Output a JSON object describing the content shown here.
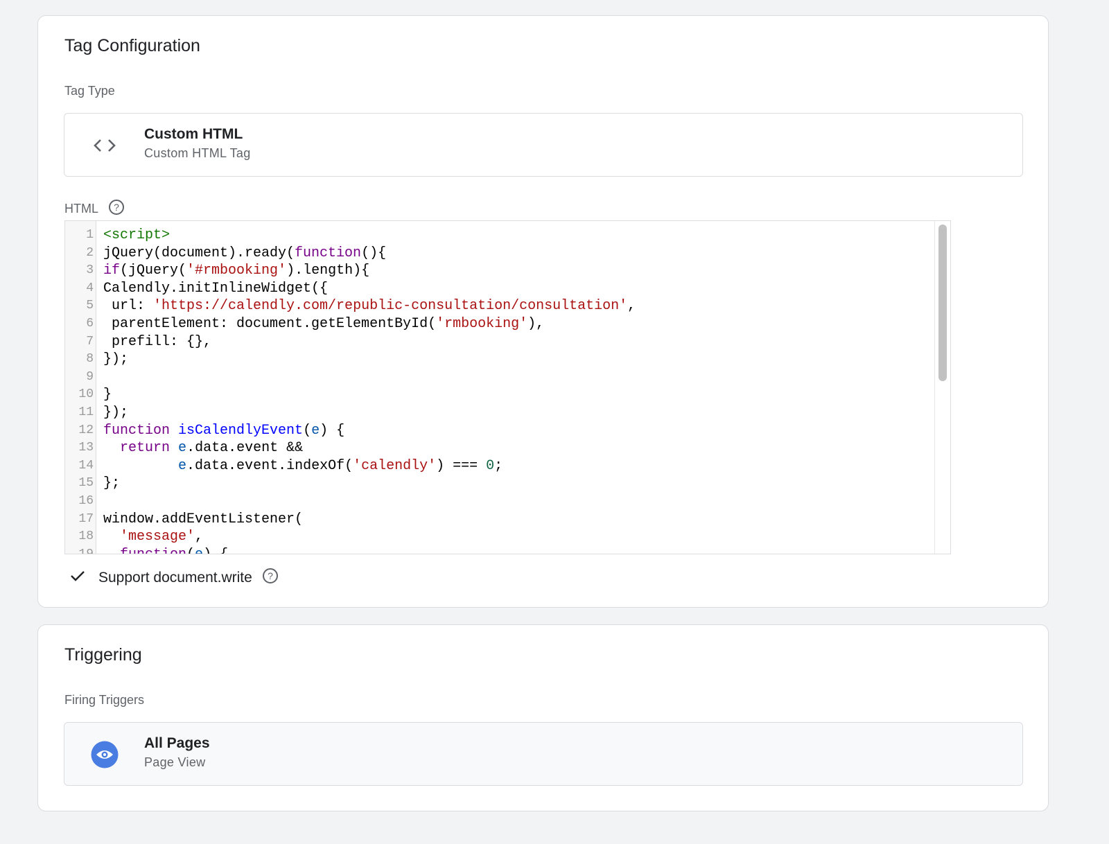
{
  "tag_configuration": {
    "title": "Tag Configuration",
    "tag_type_label": "Tag Type",
    "tag_type": {
      "name": "Custom HTML",
      "description": "Custom HTML Tag",
      "icon": "code-icon"
    },
    "html_label": "HTML",
    "code_lines": [
      [
        [
          "tag",
          "<script>"
        ]
      ],
      [
        [
          "",
          "jQuery(document).ready("
        ],
        [
          "kw",
          "function"
        ],
        [
          "",
          "(){"
        ]
      ],
      [
        [
          "kw",
          "if"
        ],
        [
          "",
          "(jQuery("
        ],
        [
          "str",
          "'#rmbooking'"
        ],
        [
          "",
          ").length){"
        ]
      ],
      [
        [
          "",
          "Calendly.initInlineWidget({"
        ]
      ],
      [
        [
          "",
          " url: "
        ],
        [
          "str",
          "'https://calendly.com/republic-consultation/consultation'"
        ],
        [
          "",
          ","
        ]
      ],
      [
        [
          "",
          " parentElement: document.getElementById("
        ],
        [
          "str",
          "'rmbooking'"
        ],
        [
          "",
          "),"
        ]
      ],
      [
        [
          "",
          " prefill: {},"
        ]
      ],
      [
        [
          "",
          "});"
        ]
      ],
      [],
      [
        [
          "",
          "}"
        ]
      ],
      [
        [
          "",
          "});"
        ]
      ],
      [
        [
          "kw",
          "function"
        ],
        [
          "",
          " "
        ],
        [
          "def",
          "isCalendlyEvent"
        ],
        [
          "",
          "("
        ],
        [
          "var",
          "e"
        ],
        [
          "",
          ") {"
        ]
      ],
      [
        [
          "",
          "  "
        ],
        [
          "kw",
          "return"
        ],
        [
          "",
          " "
        ],
        [
          "var",
          "e"
        ],
        [
          "",
          ".data.event &&"
        ]
      ],
      [
        [
          "",
          "         "
        ],
        [
          "var",
          "e"
        ],
        [
          "",
          ".data.event.indexOf("
        ],
        [
          "str",
          "'calendly'"
        ],
        [
          "",
          ") === "
        ],
        [
          "num",
          "0"
        ],
        [
          "",
          ";"
        ]
      ],
      [
        [
          "",
          "};"
        ]
      ],
      [],
      [
        [
          "",
          "window.addEventListener("
        ]
      ],
      [
        [
          "",
          "  "
        ],
        [
          "str",
          "'message'"
        ],
        [
          "",
          ","
        ]
      ],
      [
        [
          "",
          "  "
        ],
        [
          "kw",
          "function"
        ],
        [
          "",
          "("
        ],
        [
          "var",
          "e"
        ],
        [
          "",
          ") {"
        ]
      ]
    ],
    "support_document_write": {
      "label": "Support document.write",
      "checked": true
    }
  },
  "triggering": {
    "title": "Triggering",
    "firing_triggers_label": "Firing Triggers",
    "trigger": {
      "name": "All Pages",
      "type": "Page View",
      "icon": "eye-icon",
      "color": "#4a7de1"
    }
  }
}
